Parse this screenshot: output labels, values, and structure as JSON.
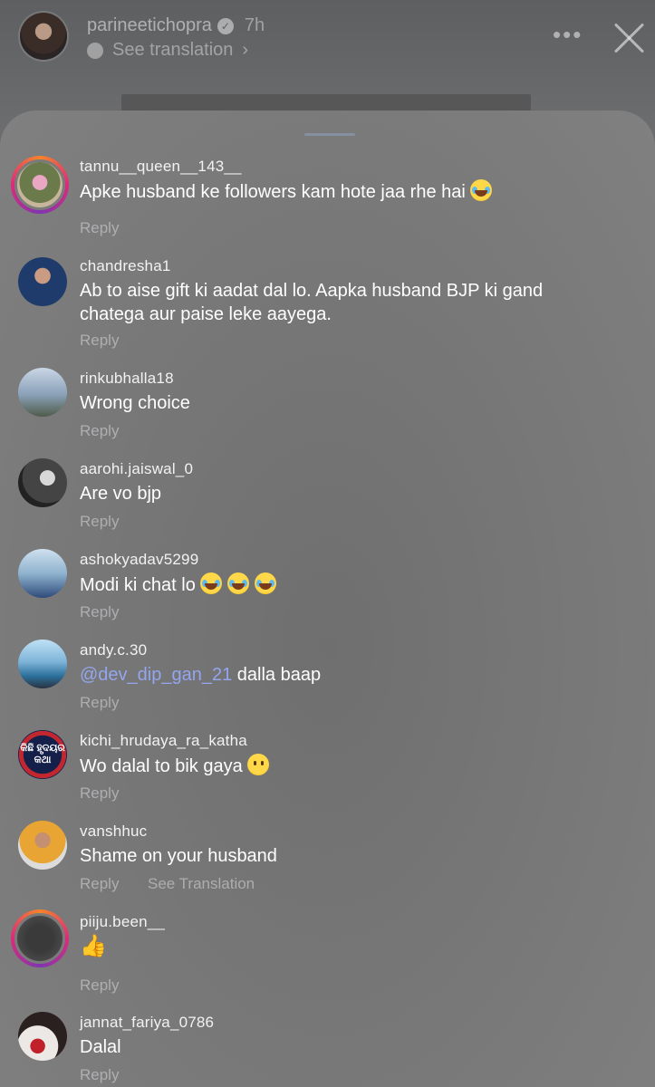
{
  "story": {
    "owner_username": "parineetichopra",
    "time_ago": "7h",
    "see_translation": "See translation",
    "verified_icon": "verified-badge-icon",
    "more_icon": "more-horizontal-icon",
    "close_icon": "close-icon"
  },
  "comments": [
    {
      "username": "tannu__queen__143__",
      "text": "Apke husband ke followers kam hote jaa rhe hai",
      "reply": "Reply"
    },
    {
      "username": "chandresha1",
      "text": "Ab to aise gift ki aadat dal lo. Aapka husband BJP ki gand chatega aur paise leke aayega.",
      "reply": "Reply"
    },
    {
      "username": "rinkubhalla18",
      "text": "Wrong choice",
      "reply": "Reply"
    },
    {
      "username": "aarohi.jaiswal_0",
      "text": "Are vo bjp",
      "reply": "Reply"
    },
    {
      "username": "ashokyadav5299",
      "text": "Modi ki chat lo",
      "reply": "Reply"
    },
    {
      "username": "andy.c.30",
      "mention": "@dev_dip_gan_21",
      "text": " dalla baap",
      "reply": "Reply"
    },
    {
      "username": "kichi_hrudaya_ra_katha",
      "text": "Wo dalal to bik gaya",
      "reply": "Reply",
      "avatar_text": "କିଛି ହୃଦୟର କଥା"
    },
    {
      "username": "vanshhuc",
      "text": "Shame on your husband",
      "reply": "Reply",
      "see_translation": "See Translation"
    },
    {
      "username": "piiju.been__",
      "text": "",
      "reply": "Reply"
    },
    {
      "username": "jannat_fariya_0786",
      "text": "Dalal",
      "reply": "Reply"
    }
  ],
  "colors": {
    "sheet_bg": "#787878",
    "mention": "#93a6ee",
    "story_ring": "#dd2a7b"
  }
}
